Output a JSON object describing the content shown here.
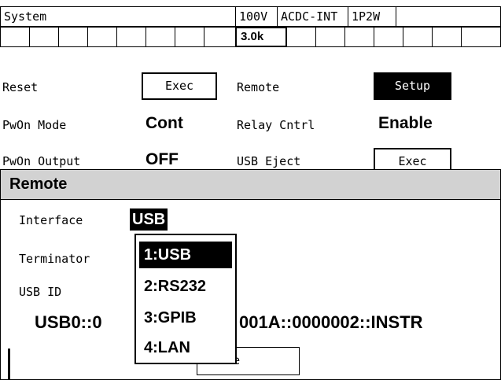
{
  "status_bar": {
    "title": "System",
    "voltage": "100V",
    "mode": "ACDC-INT",
    "wiring": "1P2W",
    "capacity": "3.0k"
  },
  "settings": {
    "reset_label": "Reset",
    "reset_button": "Exec",
    "remote_label": "Remote",
    "remote_button": "Setup",
    "pwon_mode_label": "PwOn Mode",
    "pwon_mode_value": "Cont",
    "relay_cntrl_label": "Relay Cntrl",
    "relay_cntrl_value": "Enable",
    "pwon_output_label": "PwOn Output",
    "pwon_output_value": "OFF",
    "usb_eject_label": "USB Eject",
    "usb_eject_button": "Exec"
  },
  "remote_dialog": {
    "title": "Remote",
    "interface_label": "Interface",
    "interface_value": "USB",
    "terminator_label": "Terminator",
    "usb_id_label": "USB ID",
    "usb_id_value_left": "USB0::0",
    "usb_id_value_right": "001A::0000002::INSTR",
    "close_button": "Close",
    "dropdown_options": [
      "1:USB",
      "2:RS232",
      "3:GPIB",
      "4:LAN"
    ],
    "dropdown_selected": "1:USB"
  }
}
